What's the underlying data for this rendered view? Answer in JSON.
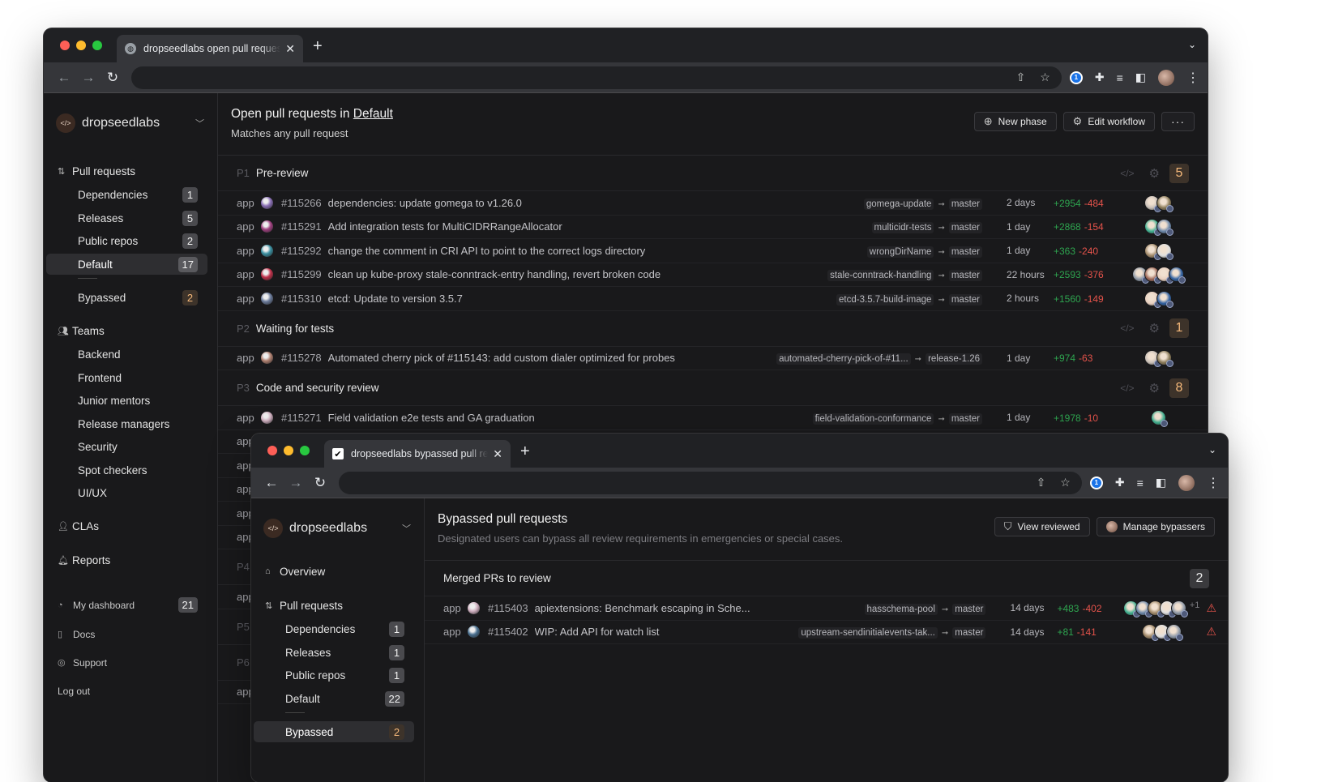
{
  "window1": {
    "tab_title": "dropseedlabs open pull requests",
    "org_name": "dropseedlabs",
    "sidebar": {
      "pull_requests_label": "Pull requests",
      "pr_items": [
        {
          "label": "Dependencies",
          "count": "1",
          "badge_style": "gray"
        },
        {
          "label": "Releases",
          "count": "5",
          "badge_style": "gray"
        },
        {
          "label": "Public repos",
          "count": "2",
          "badge_style": "gray"
        },
        {
          "label": "Default",
          "count": "17",
          "badge_style": "gray",
          "active": true
        },
        {
          "label": "Bypassed",
          "count": "2",
          "badge_style": "orange"
        }
      ],
      "teams_label": "Teams",
      "teams": [
        "Backend",
        "Frontend",
        "Junior mentors",
        "Release managers",
        "Security",
        "Spot checkers",
        "UI/UX"
      ],
      "clas_label": "CLAs",
      "reports_label": "Reports",
      "utility": [
        {
          "label": "My dashboard",
          "count": "21",
          "icon": "dashboard-icon"
        },
        {
          "label": "Docs",
          "icon": "book-icon"
        },
        {
          "label": "Support",
          "icon": "lifebuoy-icon"
        }
      ],
      "logout_label": "Log out"
    },
    "header": {
      "title_prefix": "Open pull requests in ",
      "title_link": "Default",
      "subtitle": "Matches any pull request",
      "new_phase_label": "New phase",
      "edit_workflow_label": "Edit workflow",
      "more_label": "···"
    },
    "phases": [
      {
        "num": "P1",
        "name": "Pre-review",
        "count": "5",
        "count_style": "orange",
        "prs": [
          {
            "repo": "app",
            "number": "#115266",
            "title": "dependencies: update gomega to v1.26.0",
            "head": "gomega-update",
            "base": "master",
            "age": "2 days",
            "additions": "+2954",
            "deletions": "-484",
            "reviewers": 2
          },
          {
            "repo": "app",
            "number": "#115291",
            "title": "Add integration tests for MultiCIDRRangeAllocator",
            "head": "multicidr-tests",
            "base": "master",
            "age": "1 day",
            "additions": "+2868",
            "deletions": "-154",
            "reviewers": 2
          },
          {
            "repo": "app",
            "number": "#115292",
            "title": "change the comment in CRI API to point to the correct logs directory",
            "head": "wrongDirName",
            "base": "master",
            "age": "1 day",
            "additions": "+363",
            "deletions": "-240",
            "reviewers": 2
          },
          {
            "repo": "app",
            "number": "#115299",
            "title": "clean up kube-proxy stale-conntrack-entry handling, revert broken code",
            "head": "stale-conntrack-handling",
            "base": "master",
            "age": "22 hours",
            "additions": "+2593",
            "deletions": "-376",
            "reviewers": 4
          },
          {
            "repo": "app",
            "number": "#115310",
            "title": "etcd: Update to version 3.5.7",
            "head": "etcd-3.5.7-build-image",
            "base": "master",
            "age": "2 hours",
            "additions": "+1560",
            "deletions": "-149",
            "reviewers": 2
          }
        ]
      },
      {
        "num": "P2",
        "name": "Waiting for tests",
        "count": "1",
        "count_style": "orange",
        "prs": [
          {
            "repo": "app",
            "number": "#115278",
            "title": "Automated cherry pick of #115143: add custom dialer optimized for probes",
            "head": "automated-cherry-pick-of-#11...",
            "base": "release-1.26",
            "age": "1 day",
            "additions": "+974",
            "deletions": "-63",
            "reviewers": 2
          }
        ]
      },
      {
        "num": "P3",
        "name": "Code and security review",
        "count": "8",
        "count_style": "orange",
        "prs": [
          {
            "repo": "app",
            "number": "#115271",
            "title": "Field validation e2e tests and GA graduation",
            "head": "field-validation-conformance",
            "base": "master",
            "age": "1 day",
            "additions": "+1978",
            "deletions": "-10",
            "reviewers": 1
          }
        ]
      }
    ],
    "hidden_rows": [
      "app",
      "app",
      "app",
      "app",
      "app",
      "app",
      "app"
    ],
    "hidden_phases": [
      "P4",
      "P5",
      "P6"
    ]
  },
  "window2": {
    "tab_title": "dropseedlabs bypassed pull requests",
    "org_name": "dropseedlabs",
    "sidebar": {
      "overview_label": "Overview",
      "pull_requests_label": "Pull requests",
      "pr_items": [
        {
          "label": "Dependencies",
          "count": "1"
        },
        {
          "label": "Releases",
          "count": "1"
        },
        {
          "label": "Public repos",
          "count": "1"
        },
        {
          "label": "Default",
          "count": "22"
        },
        {
          "label": "Bypassed",
          "count": "2",
          "active": true
        }
      ]
    },
    "header": {
      "title": "Bypassed pull requests",
      "subtitle": "Designated users can bypass all review requirements in emergencies or special cases.",
      "view_reviewed_label": "View reviewed",
      "manage_bypassers_label": "Manage bypassers"
    },
    "section": {
      "name": "Merged PRs to review",
      "count": "2",
      "prs": [
        {
          "repo": "app",
          "number": "#115403",
          "title": "apiextensions: Benchmark escaping in Sche...",
          "head": "hasschema-pool",
          "base": "master",
          "age": "14 days",
          "additions": "+483",
          "deletions": "-402",
          "reviewers": 5,
          "more_reviewers": "+1",
          "warning": true
        },
        {
          "repo": "app",
          "number": "#115402",
          "title": "WIP: Add API for watch list",
          "head": "upstream-sendinitialevents-tak...",
          "base": "master",
          "age": "14 days",
          "additions": "+81",
          "deletions": "-141",
          "reviewers": 3,
          "warning": true
        }
      ]
    }
  },
  "colors": {
    "additions": "#2ea44f",
    "deletions": "#e5534b",
    "orange_badge": "#f4b87a",
    "background": "#19191b"
  }
}
